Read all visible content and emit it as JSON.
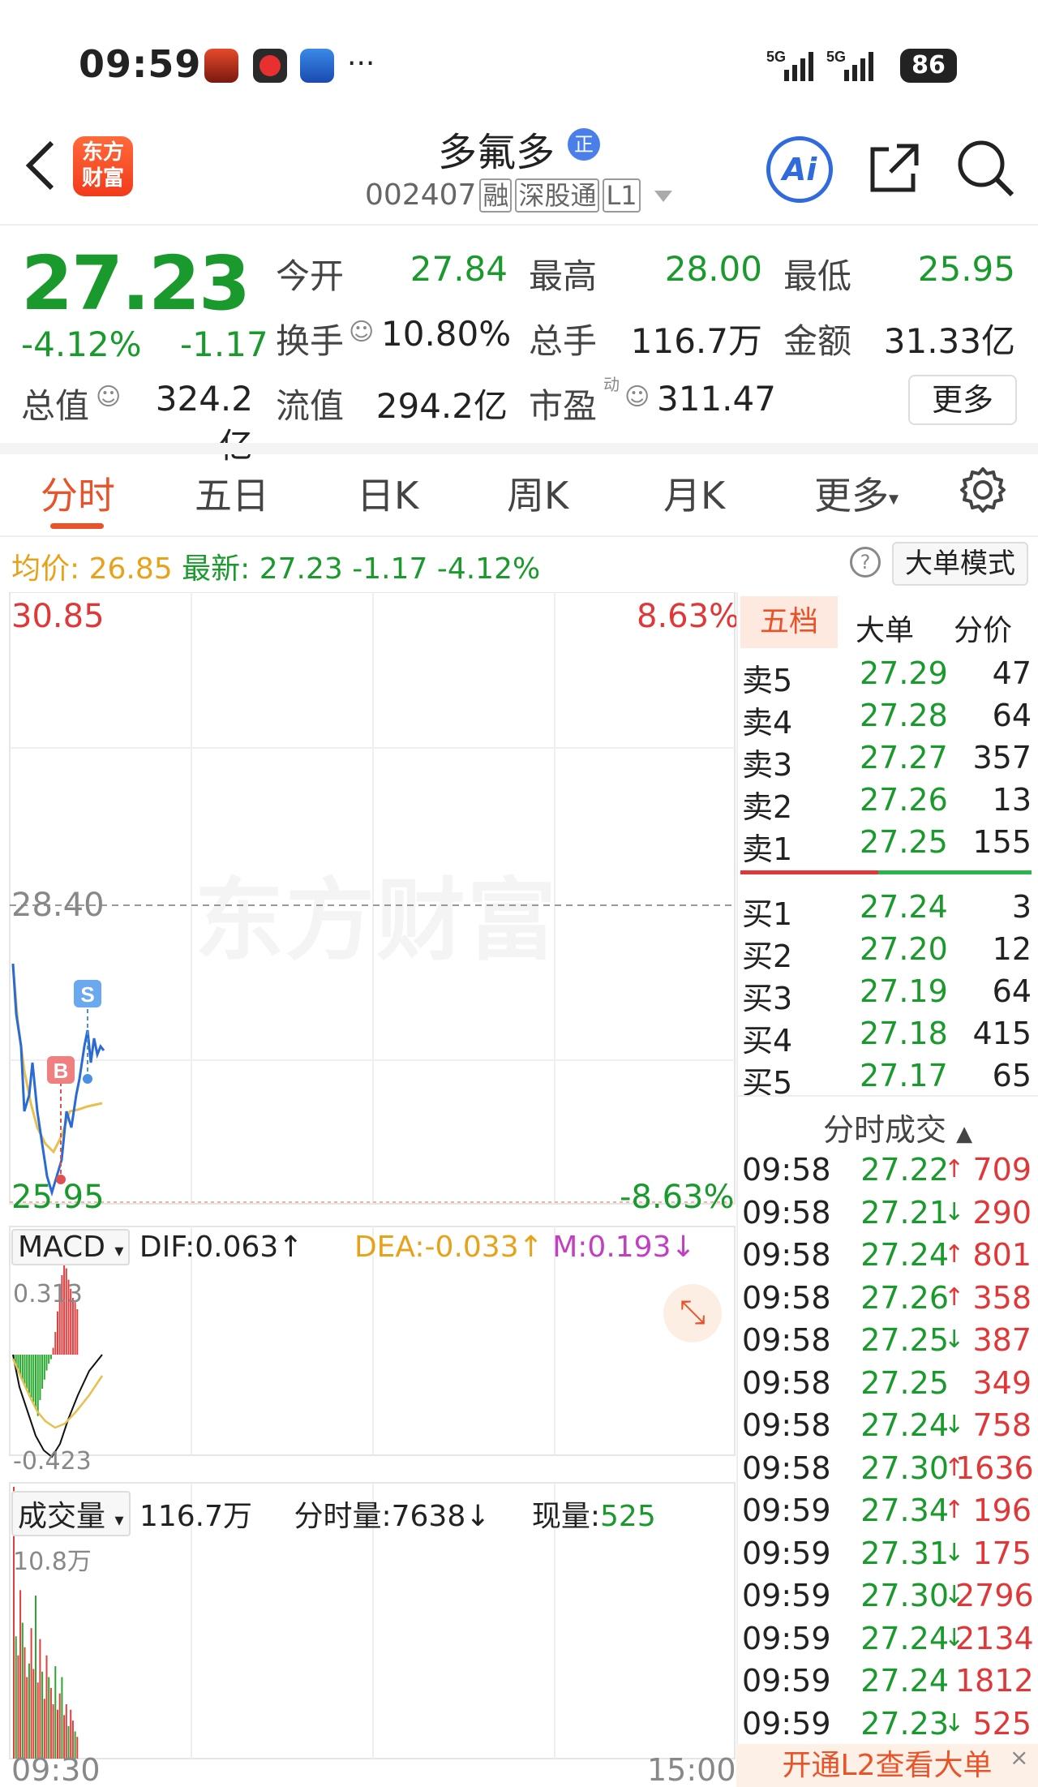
{
  "status": {
    "time": "09:59",
    "signal1": "5G",
    "signal2": "5G",
    "battery": "86",
    "more": "···"
  },
  "header": {
    "back": "‹",
    "logo": "东方财富",
    "name": "多氟多",
    "zheng_badge": "正",
    "code": "002407",
    "tags": [
      "融",
      "深股通",
      "L1"
    ],
    "ai": "Ai"
  },
  "quote": {
    "price": "27.23",
    "pct": "-4.12%",
    "change": "-1.17",
    "rows": [
      [
        {
          "label": "今开",
          "value": "27.84",
          "color": "g"
        },
        {
          "label": "最高",
          "value": "28.00",
          "color": "g"
        },
        {
          "label": "最低",
          "value": "25.95",
          "color": "g"
        }
      ],
      [
        {
          "label": "换手",
          "value": "10.80%",
          "color": "dk"
        },
        {
          "label": "总手",
          "value": "116.7万",
          "color": "dk"
        },
        {
          "label": "金额",
          "value": "31.33亿",
          "color": "dk"
        }
      ],
      [
        {
          "label": "总值",
          "value": "324.2亿",
          "color": "dk"
        },
        {
          "label": "流值",
          "value": "294.2亿",
          "color": "dk"
        },
        {
          "label": "市盈",
          "value": "311.47",
          "color": "dk"
        }
      ]
    ],
    "pe_sup": "动",
    "more": "更多"
  },
  "tabs": [
    "分时",
    "五日",
    "日K",
    "周K",
    "月K",
    "更多"
  ],
  "avg": {
    "avg_label": "均价:",
    "avg_value": "26.85",
    "latest_label": "最新:",
    "latest_value": "27.23",
    "change": "-1.17",
    "pct": "-4.12%",
    "bigmode": "大单模式",
    "help": "?"
  },
  "chart": {
    "y_high": "30.85",
    "y_mid": "28.40",
    "y_low": "25.95",
    "pct_high": "8.63%",
    "pct_low": "-8.63%",
    "watermark": "东方财富",
    "buy_mark": "B",
    "sell_mark": "S",
    "time_start": "09:30",
    "time_end": "15:00"
  },
  "macd": {
    "selector": "MACD",
    "dif": "DIF:0.063",
    "dea": "DEA:-0.033",
    "m": "M:0.193",
    "top": "0.313",
    "bottom": "-0.423"
  },
  "volume": {
    "selector": "成交量",
    "total": "116.7万",
    "min_label": "分时量:",
    "min_value": "7638",
    "now_label": "现量:",
    "now_value": "525",
    "top": "10.8万"
  },
  "orderbook": {
    "tabs": [
      "五档",
      "大单",
      "分价"
    ],
    "asks": [
      {
        "label": "卖5",
        "price": "27.29",
        "qty": "47"
      },
      {
        "label": "卖4",
        "price": "27.28",
        "qty": "64"
      },
      {
        "label": "卖3",
        "price": "27.27",
        "qty": "357"
      },
      {
        "label": "卖2",
        "price": "27.26",
        "qty": "13"
      },
      {
        "label": "卖1",
        "price": "27.25",
        "qty": "155"
      }
    ],
    "bids": [
      {
        "label": "买1",
        "price": "27.24",
        "qty": "3"
      },
      {
        "label": "买2",
        "price": "27.20",
        "qty": "12"
      },
      {
        "label": "买3",
        "price": "27.19",
        "qty": "64"
      },
      {
        "label": "买4",
        "price": "27.18",
        "qty": "415"
      },
      {
        "label": "买5",
        "price": "27.17",
        "qty": "65"
      }
    ],
    "trades_title": "分时成交",
    "trades": [
      {
        "time": "09:58",
        "price": "27.22",
        "arrow": "↑",
        "qty": "709"
      },
      {
        "time": "09:58",
        "price": "27.21",
        "arrow": "↓",
        "qty": "290"
      },
      {
        "time": "09:58",
        "price": "27.24",
        "arrow": "↑",
        "qty": "801"
      },
      {
        "time": "09:58",
        "price": "27.26",
        "arrow": "↑",
        "qty": "358"
      },
      {
        "time": "09:58",
        "price": "27.25",
        "arrow": "↓",
        "qty": "387"
      },
      {
        "time": "09:58",
        "price": "27.25",
        "arrow": "",
        "qty": "349"
      },
      {
        "time": "09:58",
        "price": "27.24",
        "arrow": "↓",
        "qty": "758"
      },
      {
        "time": "09:58",
        "price": "27.30",
        "arrow": "↑",
        "qty": "1636"
      },
      {
        "time": "09:59",
        "price": "27.34",
        "arrow": "↑",
        "qty": "196"
      },
      {
        "time": "09:59",
        "price": "27.31",
        "arrow": "↓",
        "qty": "175"
      },
      {
        "time": "09:59",
        "price": "27.30",
        "arrow": "↓",
        "qty": "2796"
      },
      {
        "time": "09:59",
        "price": "27.24",
        "arrow": "↓",
        "qty": "2134"
      },
      {
        "time": "09:59",
        "price": "27.24",
        "arrow": "",
        "qty": "1812"
      },
      {
        "time": "09:59",
        "price": "27.23",
        "arrow": "↓",
        "qty": "525"
      }
    ],
    "l2_banner": "开通L2查看大单",
    "l2_close": "×"
  },
  "colors": {
    "up": "#e03838",
    "down": "#1a9a2c",
    "accent": "#e8532a",
    "avg": "#e8a21a",
    "price_line": "#2a6ad4"
  }
}
